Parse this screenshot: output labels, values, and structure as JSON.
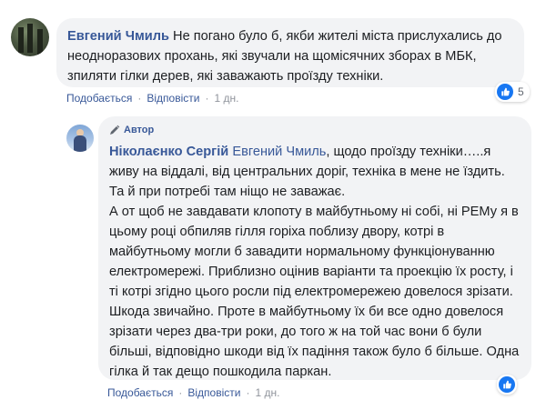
{
  "comment1": {
    "author": "Евгений Чмиль",
    "text": " Не погано було б, якби жителі міста прислухались до неодноразових прохань, які звучали на щомісячних зборах в МБК, зпиляти гілки дерев, які заважають проїзду техніки.",
    "reaction_count": "5",
    "actions": {
      "like": "Подобається",
      "reply": "Відповісти",
      "time": "1 дн."
    }
  },
  "comment2": {
    "badge": "Автор",
    "author": "Ніколаєнко Сергій",
    "mention": "Евгений Чмиль",
    "paragraph1": ", щодо проїзду техніки…..я живу на віддалі, від центральних доріг, техніка в мене не їздить. Та й при потребі там ніщо не заважає.",
    "paragraph2": "А от щоб не завдавати клопоту в майбутньому ні собі, ні РЕМу я в цьому році обпиляв гілля горіха поблизу двору, котрі в майбутньому могли б завадити нормальному функціонуванню електромережі. Приблизно оцінив варіанти та проекцію їх росту, і ті котрі згідно цього росли під електромережею довелося зрізати. Шкода звичайно. Проте в майбутньому їх би все одно довелося зрізати через два-три роки, до того ж на той час вони б були більші, відповідно шкоди від їх падіння також було б більше. Одна гілка й так дещо пошкодила паркан.",
    "actions": {
      "like": "Подобається",
      "reply": "Відповісти",
      "time": "1 дн."
    }
  },
  "colors": {
    "link": "#385898",
    "bubble": "#f2f3f5",
    "like_blue": "#1877f2"
  }
}
